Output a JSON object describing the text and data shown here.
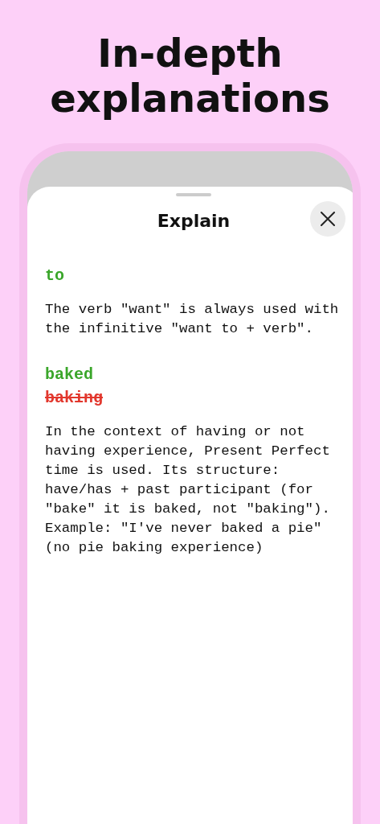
{
  "headline": "In-depth explanations",
  "sheet": {
    "title": "Explain"
  },
  "corrections": [
    {
      "items": [
        {
          "text": "to",
          "kind": "correct"
        }
      ],
      "explanation": "The verb \"want\" is always used with the infinitive \"want to + verb\"."
    },
    {
      "items": [
        {
          "text": "baked",
          "kind": "correct"
        },
        {
          "text": "baking",
          "kind": "wrong"
        }
      ],
      "explanation": "In the context of having or not having experience, Present Perfect time is used. Its structure: have/has + past participant (for \"bake\" it is baked, not \"baking\"). Example: \"I've never baked a pie\" (no pie baking experience)"
    }
  ]
}
